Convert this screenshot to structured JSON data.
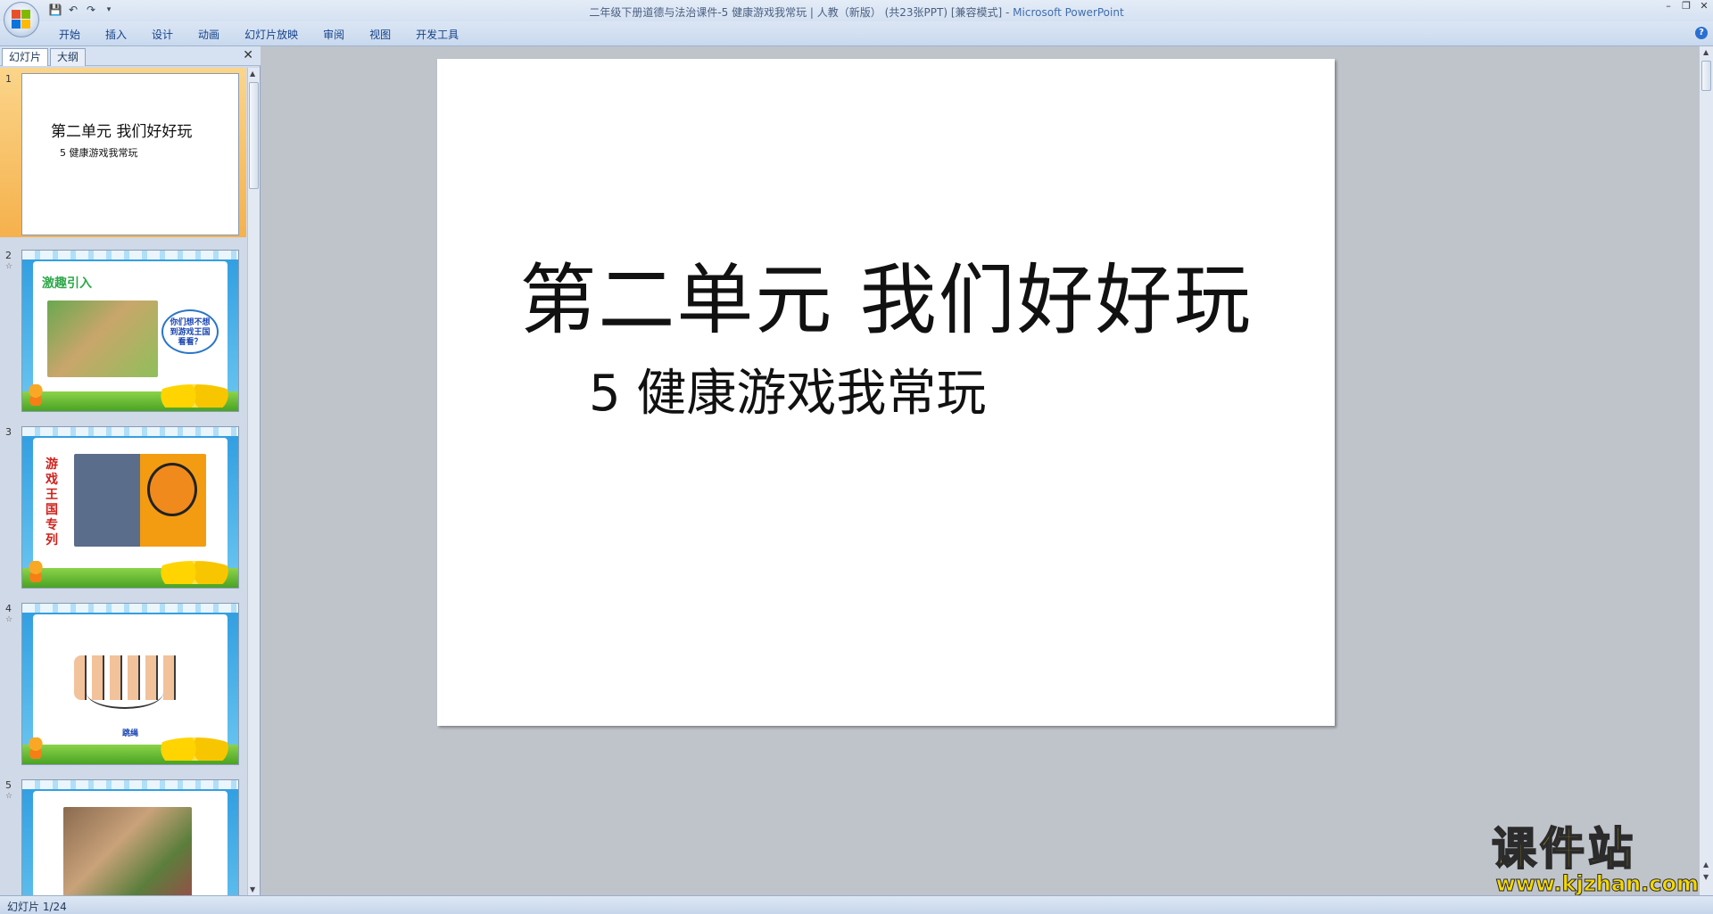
{
  "window": {
    "title": "二年级下册道德与法治课件-5   健康游戏我常玩 | 人教（新版） (共23张PPT) [兼容模式] - ",
    "app_name": "Microsoft PowerPoint"
  },
  "ribbon_tabs": [
    "开始",
    "插入",
    "设计",
    "动画",
    "幻灯片放映",
    "审阅",
    "视图",
    "开发工具"
  ],
  "pane_tabs": {
    "slides": "幻灯片",
    "outline": "大纲"
  },
  "thumbnails": [
    {
      "num": "1",
      "title": "第二单元  我们好好玩",
      "subtitle": "5  健康游戏我常玩"
    },
    {
      "num": "2",
      "heading": "激趣引入",
      "bubble": "你们想不想到游戏王国看看？"
    },
    {
      "num": "3",
      "side_text": "游戏王国专列"
    },
    {
      "num": "4",
      "caption": "跳绳"
    },
    {
      "num": "5"
    }
  ],
  "slide": {
    "title": "第二单元  我们好好玩",
    "subtitle": "5  健康游戏我常玩"
  },
  "status": {
    "slide_counter": "幻灯片 1/24"
  },
  "watermark": {
    "text": "课件站",
    "url": "www.kjzhan.com"
  }
}
